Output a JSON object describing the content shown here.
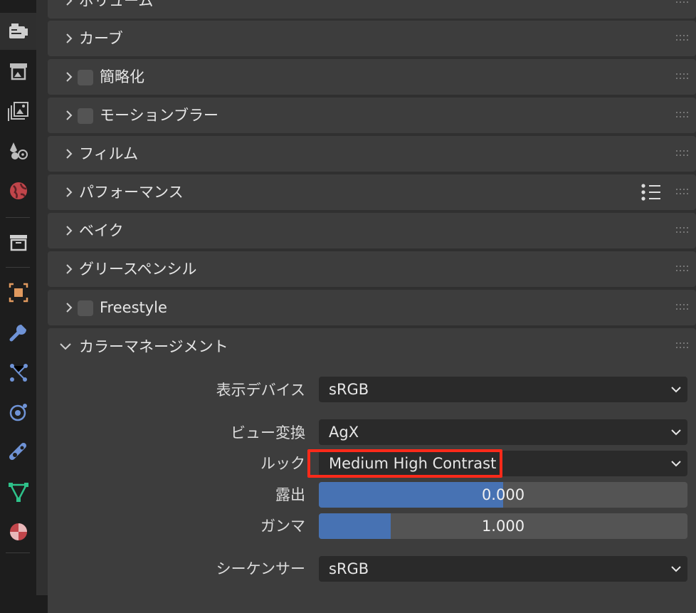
{
  "tabs": [
    {
      "icon": "render-icon",
      "active": true
    },
    {
      "icon": "output-icon",
      "active": false
    },
    {
      "icon": "view-layer-icon",
      "active": false
    },
    {
      "icon": "scene-icon",
      "active": false
    },
    {
      "icon": "world-icon",
      "active": false
    },
    {
      "icon": "collection-icon",
      "active": false
    },
    {
      "icon": "object-icon",
      "active": false
    },
    {
      "icon": "modifier-wrench-icon",
      "active": false
    },
    {
      "icon": "particles-icon",
      "active": false
    },
    {
      "icon": "physics-icon",
      "active": false
    },
    {
      "icon": "constraints-icon",
      "active": false
    },
    {
      "icon": "object-data-icon",
      "active": false
    },
    {
      "icon": "material-icon",
      "active": false
    }
  ],
  "panels": [
    {
      "title": "ボリューム",
      "checkbox": false
    },
    {
      "title": "カーブ",
      "checkbox": false
    },
    {
      "title": "簡略化",
      "checkbox": true
    },
    {
      "title": "モーションブラー",
      "checkbox": true
    },
    {
      "title": "フィルム",
      "checkbox": false
    },
    {
      "title": "パフォーマンス",
      "checkbox": false
    },
    {
      "title": "ベイク",
      "checkbox": false
    },
    {
      "title": "グリースペンシル",
      "checkbox": false
    },
    {
      "title": "Freestyle",
      "checkbox": true
    }
  ],
  "color_management": {
    "title": "カラーマネージメント",
    "display_device": {
      "label": "表示デバイス",
      "value": "sRGB"
    },
    "view_transform": {
      "label": "ビュー変換",
      "value": "AgX"
    },
    "look": {
      "label": "ルック",
      "value": "Medium High Contrast"
    },
    "exposure": {
      "label": "露出",
      "value": "0.000",
      "fill_fraction": 0.5
    },
    "gamma": {
      "label": "ガンマ",
      "value": "1.000",
      "fill_fraction": 0.195
    },
    "sequencer": {
      "label": "シーケンサー",
      "value": "sRGB"
    }
  },
  "colors": {
    "slider_fill": "#4772b3",
    "highlight": "#ff2a1a"
  }
}
